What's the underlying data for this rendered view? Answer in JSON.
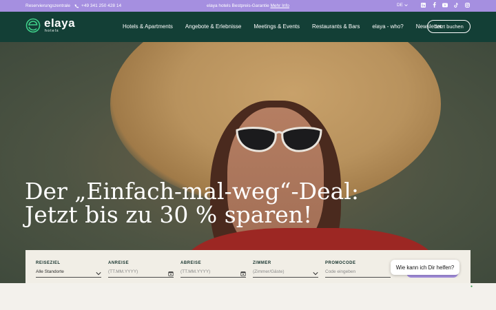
{
  "topbar": {
    "reservation_label": "Reservierungszentrale",
    "phone": "+49 341 250 428 14",
    "guarantee_text": "elaya hotels Bestpreis-Garantie",
    "guarantee_link": "Mehr Info",
    "language": "DE",
    "social_icons": [
      "linkedin-icon",
      "facebook-icon",
      "youtube-icon",
      "tiktok-icon",
      "instagram-icon"
    ]
  },
  "nav": {
    "logo_word": "elaya",
    "logo_sub": "hotels",
    "items": [
      "Hotels & Apartments",
      "Angebote & Erlebnisse",
      "Meetings & Events",
      "Restaurants & Bars",
      "elaya - who?",
      "Newsletter"
    ],
    "cta": "Jetzt buchen"
  },
  "hero": {
    "headline_line1": "Der „Einfach-mal-weg“-Deal:",
    "headline_line2": "Jetzt bis zu 30 % sparen!"
  },
  "booking": {
    "destination_label": "REISEZIEL",
    "destination_value": "Alle Standorte",
    "arrival_label": "ANREISE",
    "arrival_placeholder": "(TT.MM.YYYY)",
    "departure_label": "ABREISE",
    "departure_placeholder": "(TT.MM.YYYY)",
    "rooms_label": "ZIMMER",
    "rooms_placeholder": "(Zimmer/Gäste)",
    "promo_label": "PROMOCODE",
    "promo_placeholder": "Code eingeben"
  },
  "chat": {
    "prompt": "Wie kann ich Dir helfen?"
  },
  "colors": {
    "topbar": "#a58fe0",
    "nav": "#133f36",
    "panel": "#f1eee6"
  }
}
